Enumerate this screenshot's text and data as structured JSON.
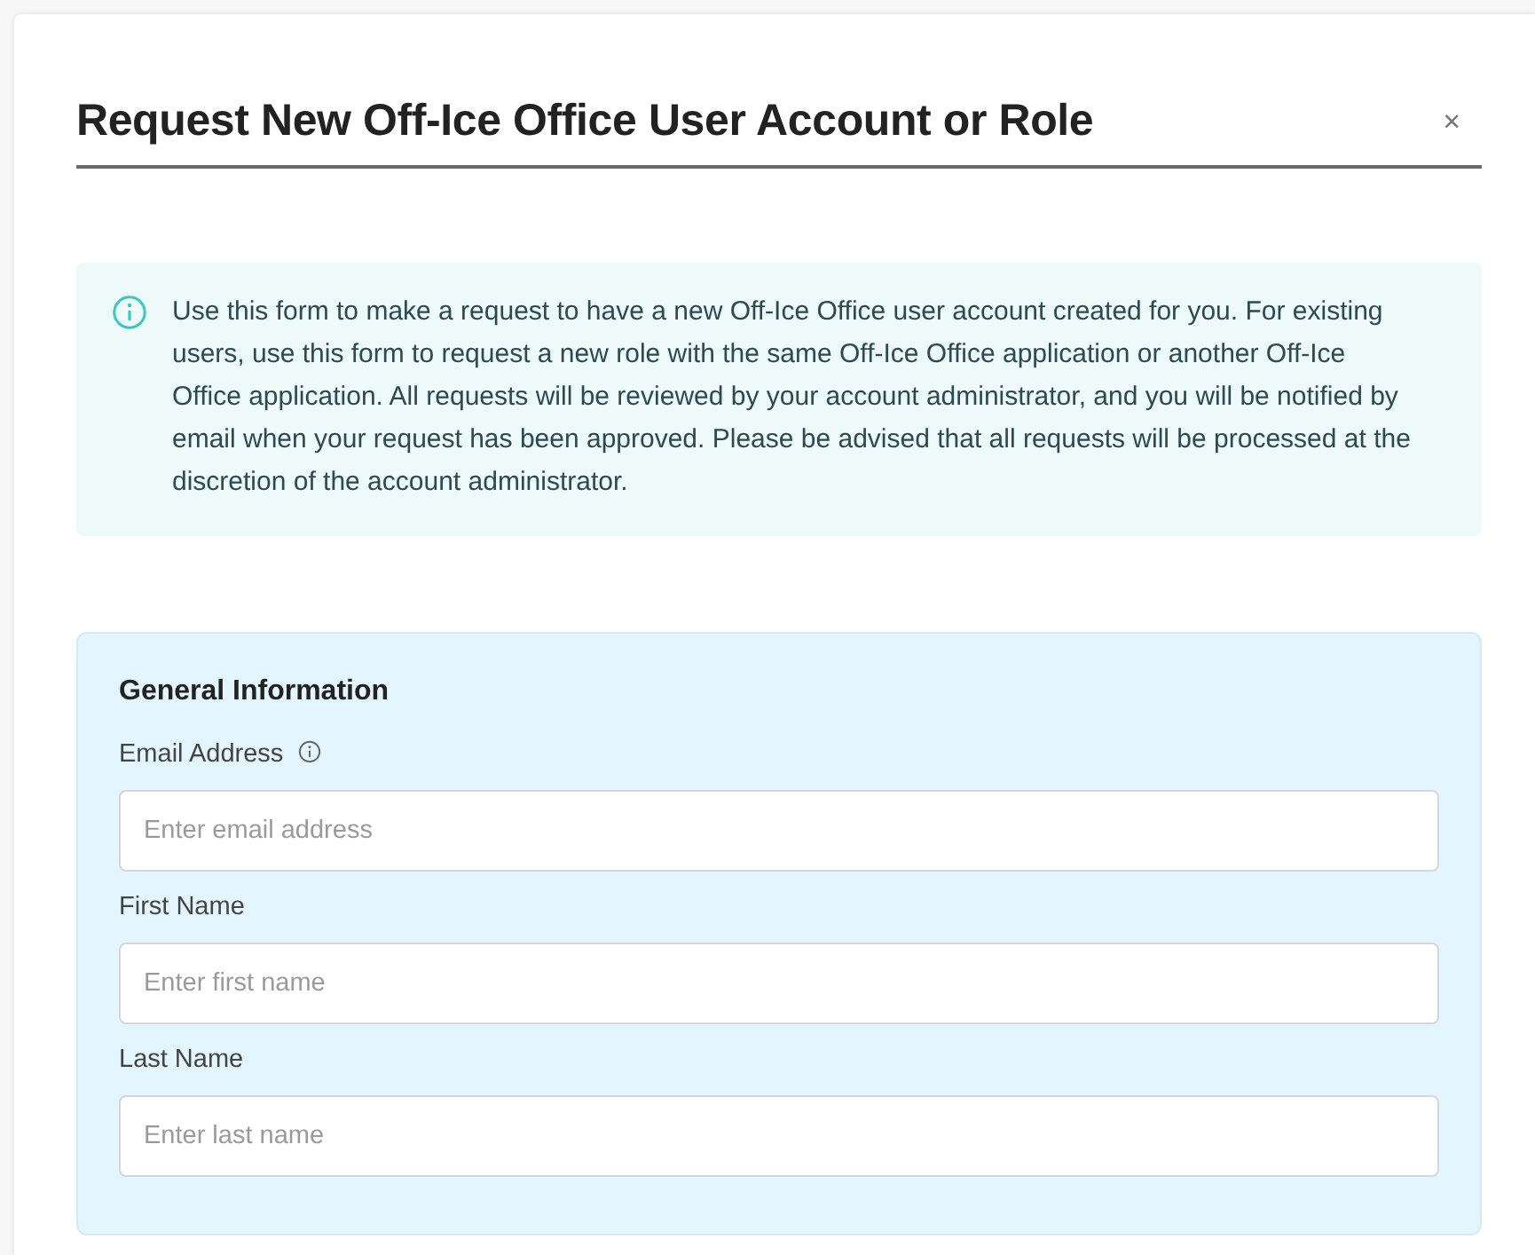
{
  "dialog": {
    "title": "Request New Off-Ice Office User Account or Role",
    "close": "×"
  },
  "notice": {
    "text": "Use this form to make a request to have a new Off-Ice Office user account created for you. For existing users, use this form to request a new role with the same Off-Ice Office application or another Off-Ice Office application. All requests will be reviewed by your account administrator, and you will be notified by email when your request has been approved. Please be advised that all requests will be processed at the discretion of the account administrator."
  },
  "section": {
    "title": "General Information",
    "fields": [
      {
        "label": "Email Address",
        "info": true,
        "placeholder": "Enter email address"
      },
      {
        "label": "First Name",
        "info": false,
        "placeholder": "Enter first name"
      },
      {
        "label": "Last Name",
        "info": false,
        "placeholder": "Enter last name"
      }
    ]
  }
}
